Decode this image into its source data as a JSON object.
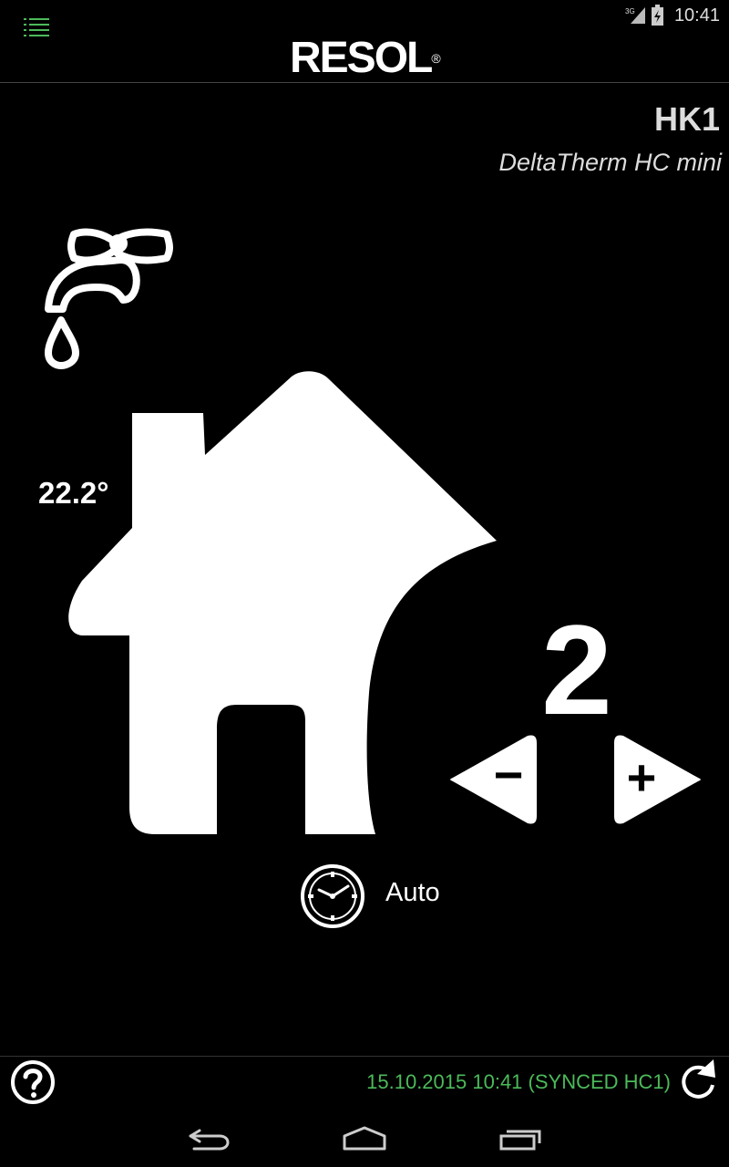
{
  "status_bar": {
    "network": "3G",
    "time": "10:41"
  },
  "app_bar": {
    "logo": "RESOL",
    "logo_mark": "®",
    "menu_icon": "menu-list-icon"
  },
  "circuit": {
    "title": "HK1",
    "device": "DeltaTherm HC mini"
  },
  "room": {
    "temperature": "22.2°"
  },
  "heating_level": {
    "value": "2",
    "decrease_label": "−",
    "increase_label": "+"
  },
  "mode": {
    "label": "Auto",
    "icon": "clock-icon"
  },
  "footer": {
    "help_icon": "help-icon",
    "sync_status": "15.10.2015 10:41 (SYNCED HC1)",
    "refresh_icon": "refresh-icon",
    "sync_color": "#4cba5a"
  },
  "nav_bar": {
    "back_icon": "back-icon",
    "home_icon": "home-icon",
    "recents_icon": "recents-icon"
  }
}
